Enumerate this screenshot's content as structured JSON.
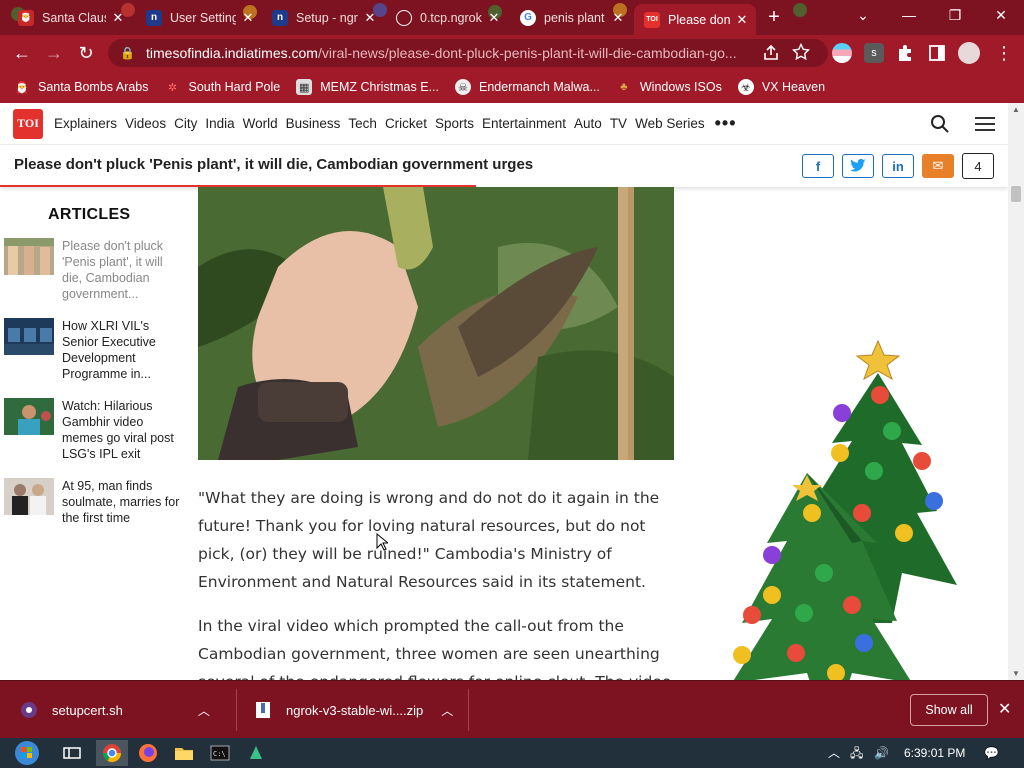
{
  "browser": {
    "tabs": [
      {
        "title": "Santa Claus",
        "favicon": "santa-icon",
        "active": false
      },
      {
        "title": "User Settings",
        "favicon": "ngrok-n-icon",
        "active": false
      },
      {
        "title": "Setup - ngrok",
        "favicon": "ngrok-n-icon",
        "active": false
      },
      {
        "title": "0.tcp.ngrok",
        "favicon": "globe-icon",
        "active": false
      },
      {
        "title": "penis plant",
        "favicon": "google-icon",
        "active": false
      },
      {
        "title": "Please don't pluck",
        "favicon": "toi-icon",
        "active": true
      }
    ],
    "new_tab_label": "+",
    "window_controls": {
      "minimize": "—",
      "restore": "❐",
      "close": "✕",
      "tab_search": "⌄"
    },
    "address": {
      "domain": "timesofindia.indiatimes.com",
      "path": "/viral-news/please-dont-pluck-penis-plant-it-will-die-cambodian-go..."
    },
    "bookmarks": [
      {
        "label": "Santa Bombs Arabs",
        "icon": "santa-icon"
      },
      {
        "label": "South Hard Pole",
        "icon": "snowflake-icon"
      },
      {
        "label": "MEMZ Christmas E...",
        "icon": "memz-icon"
      },
      {
        "label": "Endermanch Malwa...",
        "icon": "skull-icon"
      },
      {
        "label": "Windows ISOs",
        "icon": "tree-icon"
      },
      {
        "label": "VX Heaven",
        "icon": "biohazard-icon"
      }
    ]
  },
  "site": {
    "logo": "TOI",
    "nav": [
      "Explainers",
      "Videos",
      "City",
      "India",
      "World",
      "Business",
      "Tech",
      "Cricket",
      "Sports",
      "Entertainment",
      "Auto",
      "TV",
      "Web Series"
    ],
    "more": "•••",
    "headline": "Please don't pluck 'Penis plant', it will die, Cambodian government urges",
    "comment_count": "4",
    "share": {
      "facebook": "f",
      "twitter": "t",
      "linkedin": "in",
      "email": "✉"
    }
  },
  "sidebar": {
    "heading": "ARTICLES",
    "articles": [
      {
        "title": "Please don't pluck 'Penis plant', it will die, Cambodian government..."
      },
      {
        "title": "How XLRI VIL's Senior Executive Development Programme in..."
      },
      {
        "title": "Watch: Hilarious Gambhir video memes go viral post LSG's IPL exit"
      },
      {
        "title": "At 95, man finds soulmate, marries for the first time"
      }
    ]
  },
  "article": {
    "paragraphs": [
      "\"What they are doing is wrong and do not do it again in the future! Thank you for loving natural resources, but do not pick, (or) they will be ruined!\" Cambodia's Ministry of Environment and Natural Resources said in its statement.",
      "In the viral video which prompted the call-out from the Cambodian government, three women are seen unearthing several of the endangered flowers for online clout. The video"
    ]
  },
  "downloads": {
    "items": [
      {
        "name": "setupcert.sh"
      },
      {
        "name": "ngrok-v3-stable-wi....zip"
      }
    ],
    "show_all": "Show all",
    "close": "✕"
  },
  "taskbar": {
    "clock": "6:39:01 PM"
  },
  "colors": {
    "chrome_dark": "#7d1220",
    "chrome": "#a01a2a",
    "toi_red": "#e3312d",
    "share_blue": "#1b6ec2",
    "email_orange": "#e8802a"
  }
}
